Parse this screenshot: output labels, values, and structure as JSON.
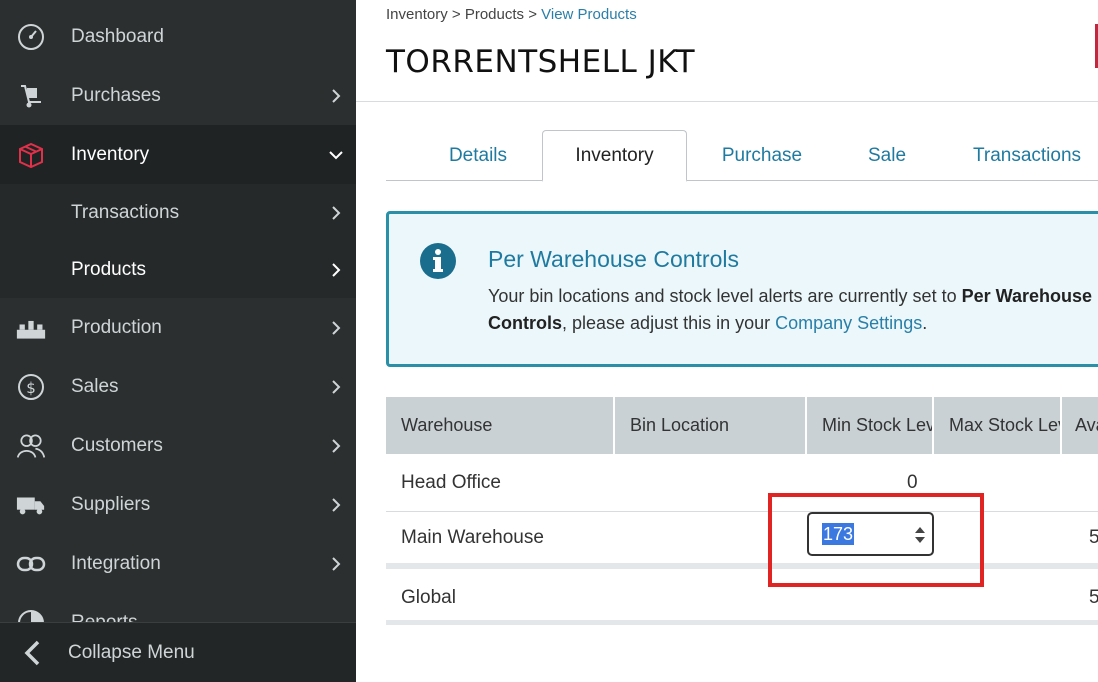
{
  "sidebar": {
    "items": [
      {
        "label": "Dashboard",
        "icon": "dashboard-gauge-icon"
      },
      {
        "label": "Purchases",
        "icon": "hand-truck-icon"
      },
      {
        "label": "Inventory",
        "icon": "box-icon"
      },
      {
        "label": "Production",
        "icon": "factory-icon"
      },
      {
        "label": "Sales",
        "icon": "dollar-coin-icon"
      },
      {
        "label": "Customers",
        "icon": "customers-icon"
      },
      {
        "label": "Suppliers",
        "icon": "truck-icon"
      },
      {
        "label": "Integration",
        "icon": "link-icon"
      },
      {
        "label": "Reports",
        "icon": "pie-chart-icon"
      }
    ],
    "inventory_sub": [
      {
        "label": "Transactions"
      },
      {
        "label": "Products"
      }
    ],
    "collapse_label": "Collapse Menu"
  },
  "header": {
    "breadcrumb": {
      "part1": "Inventory",
      "sep": ">",
      "part2": "Products",
      "part3": "View Products"
    },
    "title": "TORRENTSHELL JKT"
  },
  "tabs": [
    {
      "label": "Details"
    },
    {
      "label": "Inventory"
    },
    {
      "label": "Purchase"
    },
    {
      "label": "Sale"
    },
    {
      "label": "Transactions"
    }
  ],
  "info": {
    "title": "Per Warehouse Controls",
    "body_pre": "Your bin locations and stock level alerts are currently set to ",
    "body_bold": "Per Warehouse Controls",
    "body_mid": ", please adjust this in your ",
    "body_link": "Company Settings",
    "body_end": "."
  },
  "table": {
    "headers": [
      "Warehouse",
      "Bin Location",
      "Min Stock Level",
      "Max Stock Level",
      "Available"
    ],
    "rows": [
      {
        "warehouse": "Head Office",
        "min": "0",
        "avail": ""
      },
      {
        "warehouse": "Main Warehouse",
        "min_input": "173",
        "avail": "5"
      },
      {
        "warehouse": "Global",
        "avail": "5"
      }
    ]
  },
  "colors": {
    "sidebar_bg": "#2b2f30",
    "accent": "#1f7aa0",
    "highlight_box": "#e02424",
    "info_border": "#2a90a8"
  }
}
